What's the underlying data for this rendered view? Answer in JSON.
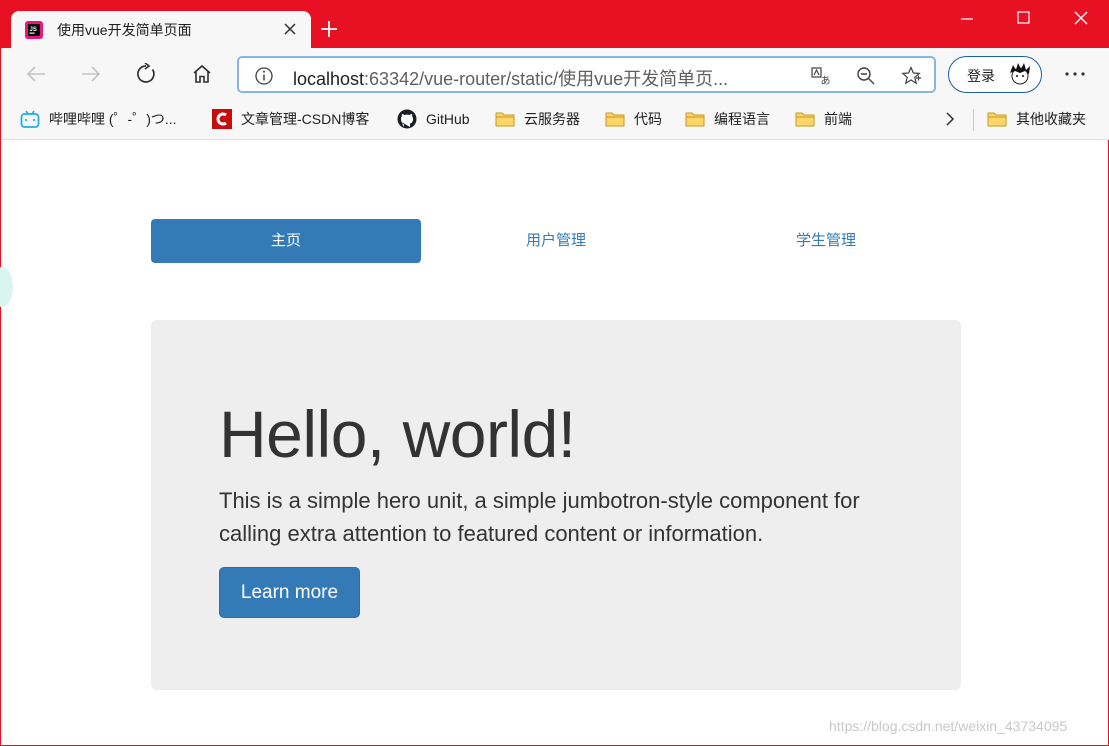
{
  "browser": {
    "tab_title": "使用vue开发简单页面",
    "address": {
      "host": "localhost",
      "rest": ":63342/vue-router/static/使用vue开发简单页..."
    },
    "login_label": "登录",
    "bookmarks": [
      {
        "label": "哔哩哔哩 (゜-゜)つ...",
        "icon": "bilibili-icon"
      },
      {
        "label": "文章管理-CSDN博客",
        "icon": "csdn-icon"
      },
      {
        "label": "GitHub",
        "icon": "github-icon"
      },
      {
        "label": "云服务器",
        "icon": "folder-icon"
      },
      {
        "label": "代码",
        "icon": "folder-icon"
      },
      {
        "label": "编程语言",
        "icon": "folder-icon"
      },
      {
        "label": "前端",
        "icon": "folder-icon"
      }
    ],
    "other_bookmarks_label": "其他收藏夹",
    "colors": {
      "frame": "#e81123",
      "toolbar": "#f7f7f7",
      "omnibox_border": "#8ab4e6"
    }
  },
  "page": {
    "nav": [
      {
        "label": "主页",
        "active": true
      },
      {
        "label": "用户管理",
        "active": false
      },
      {
        "label": "学生管理",
        "active": false
      }
    ],
    "hero": {
      "title": "Hello, world!",
      "text": "This is a simple hero unit, a simple jumbotron-style component for calling extra attention to featured content or information.",
      "button_label": "Learn more"
    },
    "watermark": "https://blog.csdn.net/weixin_43734095",
    "colors": {
      "primary": "#337ab7",
      "jumbotron": "#eeeeee",
      "text": "#333333"
    }
  }
}
